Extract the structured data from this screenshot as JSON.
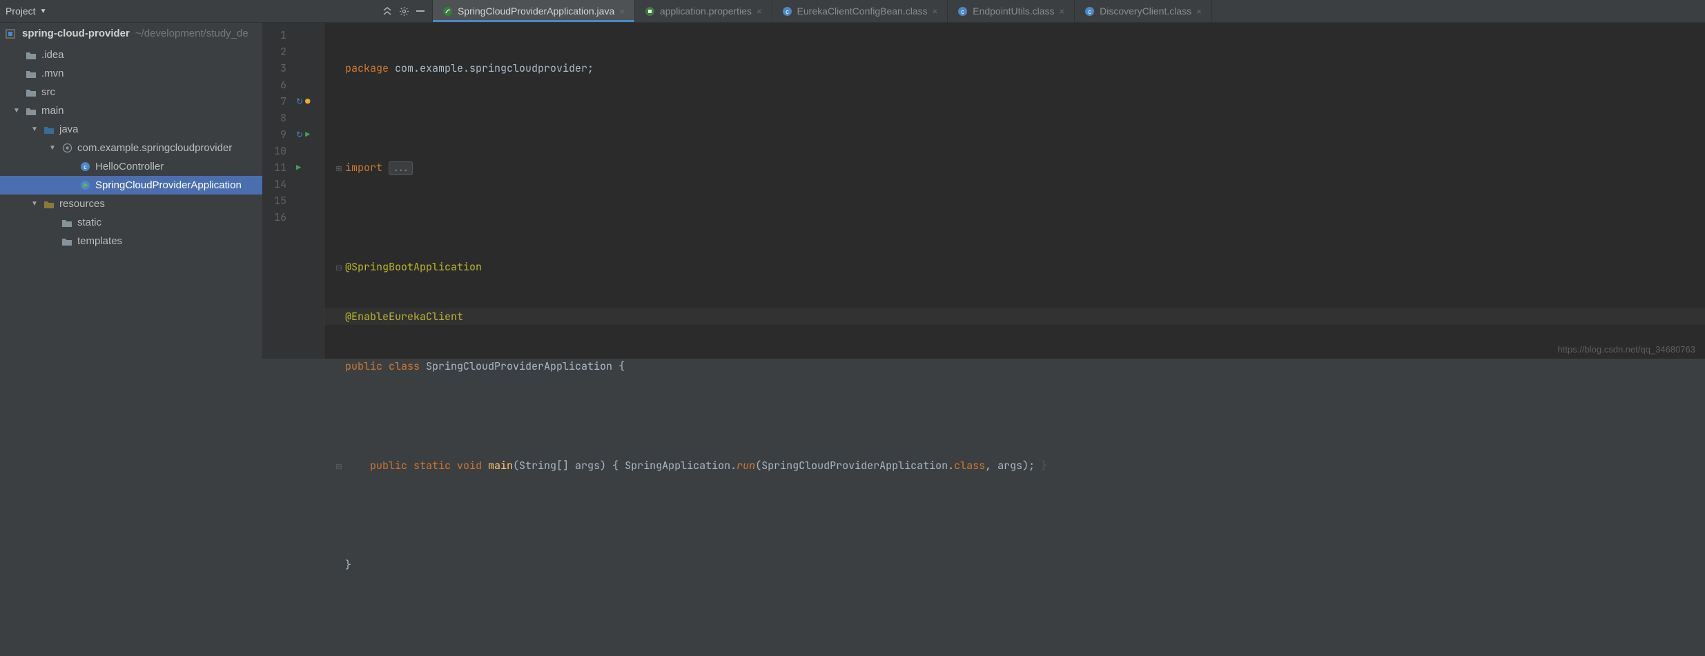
{
  "header": {
    "title": "Project",
    "collapse_icon": "collapse-icon",
    "gear_icon": "gear-icon",
    "hide_icon": "hide-icon"
  },
  "tabs": [
    {
      "label": "SpringCloudProviderApplication.java",
      "icon": "java-spring",
      "active": true
    },
    {
      "label": "application.properties",
      "icon": "spring-props",
      "active": false
    },
    {
      "label": "EurekaClientConfigBean.class",
      "icon": "class-ro",
      "active": false
    },
    {
      "label": "EndpointUtils.class",
      "icon": "class-ro",
      "active": false
    },
    {
      "label": "DiscoveryClient.class",
      "icon": "class-ro",
      "active": false
    }
  ],
  "breadcrumb": {
    "project": "spring-cloud-provider",
    "path": "~/development/study_de"
  },
  "tree": [
    {
      "depth": 0,
      "arrow": "",
      "icon": "folder",
      "label": ".idea"
    },
    {
      "depth": 0,
      "arrow": "",
      "icon": "folder",
      "label": ".mvn"
    },
    {
      "depth": 0,
      "arrow": "",
      "icon": "folder",
      "label": "src"
    },
    {
      "depth": 0,
      "arrow": "down",
      "icon": "folder",
      "label": "main"
    },
    {
      "depth": 1,
      "arrow": "down",
      "icon": "src-folder",
      "label": "java"
    },
    {
      "depth": 2,
      "arrow": "down",
      "icon": "package",
      "label": "com.example.springcloudprovider"
    },
    {
      "depth": 3,
      "arrow": "",
      "icon": "class",
      "label": "HelloController"
    },
    {
      "depth": 3,
      "arrow": "",
      "icon": "class-run",
      "label": "SpringCloudProviderApplication",
      "selected": true
    },
    {
      "depth": 1,
      "arrow": "down",
      "icon": "res-folder",
      "label": "resources"
    },
    {
      "depth": 2,
      "arrow": "",
      "icon": "folder",
      "label": "static"
    },
    {
      "depth": 2,
      "arrow": "",
      "icon": "folder",
      "label": "templates"
    }
  ],
  "code": {
    "lines": [
      "1",
      "2",
      "3",
      "6",
      "7",
      "8",
      "9",
      "10",
      "11",
      "14",
      "15",
      "16"
    ],
    "l1_kw": "package",
    "l1_pkg": " com.example.springcloudprovider;",
    "l3_kw": "import",
    "l3_fold": "...",
    "l7_ann": "@SpringBootApplication",
    "l8_ann": "@EnableEurekaClient",
    "l9_kw": "public class",
    "l9_cls": " SpringCloudProviderApplication {",
    "l11_kw1": "public static void",
    "l11_m": " main",
    "l11_args": "(String[] args) { ",
    "l11_cls2": "SpringApplication",
    "l11_dot": ".",
    "l11_run": "run",
    "l11_tail1": "(SpringCloudProviderApplication.",
    "l11_kwclass": "class",
    "l11_tail2": ", args); ",
    "l11_brace": "}",
    "l15_brace": "}"
  },
  "watermark": "https://blog.csdn.net/qq_34680763"
}
